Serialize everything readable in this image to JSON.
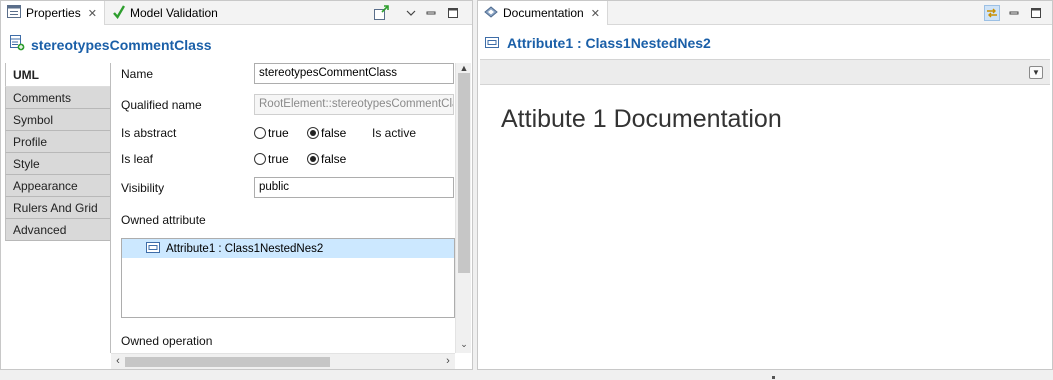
{
  "left_panel": {
    "tabs": [
      {
        "label": "Properties",
        "icon": "properties-icon",
        "active": true
      },
      {
        "label": "Model Validation",
        "icon": "checkmark-icon",
        "active": false
      }
    ],
    "title": "stereotypesCommentClass",
    "side_tabs": [
      "UML",
      "Comments",
      "Symbol",
      "Profile",
      "Style",
      "Appearance",
      "Rulers And Grid",
      "Advanced"
    ],
    "selected_side_tab": "UML",
    "properties": {
      "name_label": "Name",
      "name_value": "stereotypesCommentClass",
      "qualified_name_label": "Qualified name",
      "qualified_name_value": "RootElement::stereotypesCommentClass",
      "is_abstract_label": "Is abstract",
      "is_abstract_true": "true",
      "is_abstract_false": "false",
      "is_abstract_selected": "false",
      "is_active_label": "Is active",
      "is_leaf_label": "Is leaf",
      "is_leaf_true": "true",
      "is_leaf_false": "false",
      "is_leaf_selected": "false",
      "visibility_label": "Visibility",
      "visibility_value": "public",
      "owned_attribute_label": "Owned attribute",
      "owned_attributes": [
        "Attribute1 : Class1NestedNes2"
      ],
      "owned_operation_label": "Owned operation"
    },
    "vertical_scroll_fraction": 0.7,
    "horizontal_scroll_fraction": 0.6
  },
  "right_panel": {
    "tabs": [
      {
        "label": "Documentation",
        "icon": "documentation-icon",
        "active": true
      }
    ],
    "title": "Attribute1 : Class1NestedNes2",
    "doc_text": "Attibute 1 Documentation"
  },
  "colors": {
    "title_blue": "#1a5fa8",
    "selection": "#cce8ff",
    "validation_green": "#2e9e2e"
  }
}
